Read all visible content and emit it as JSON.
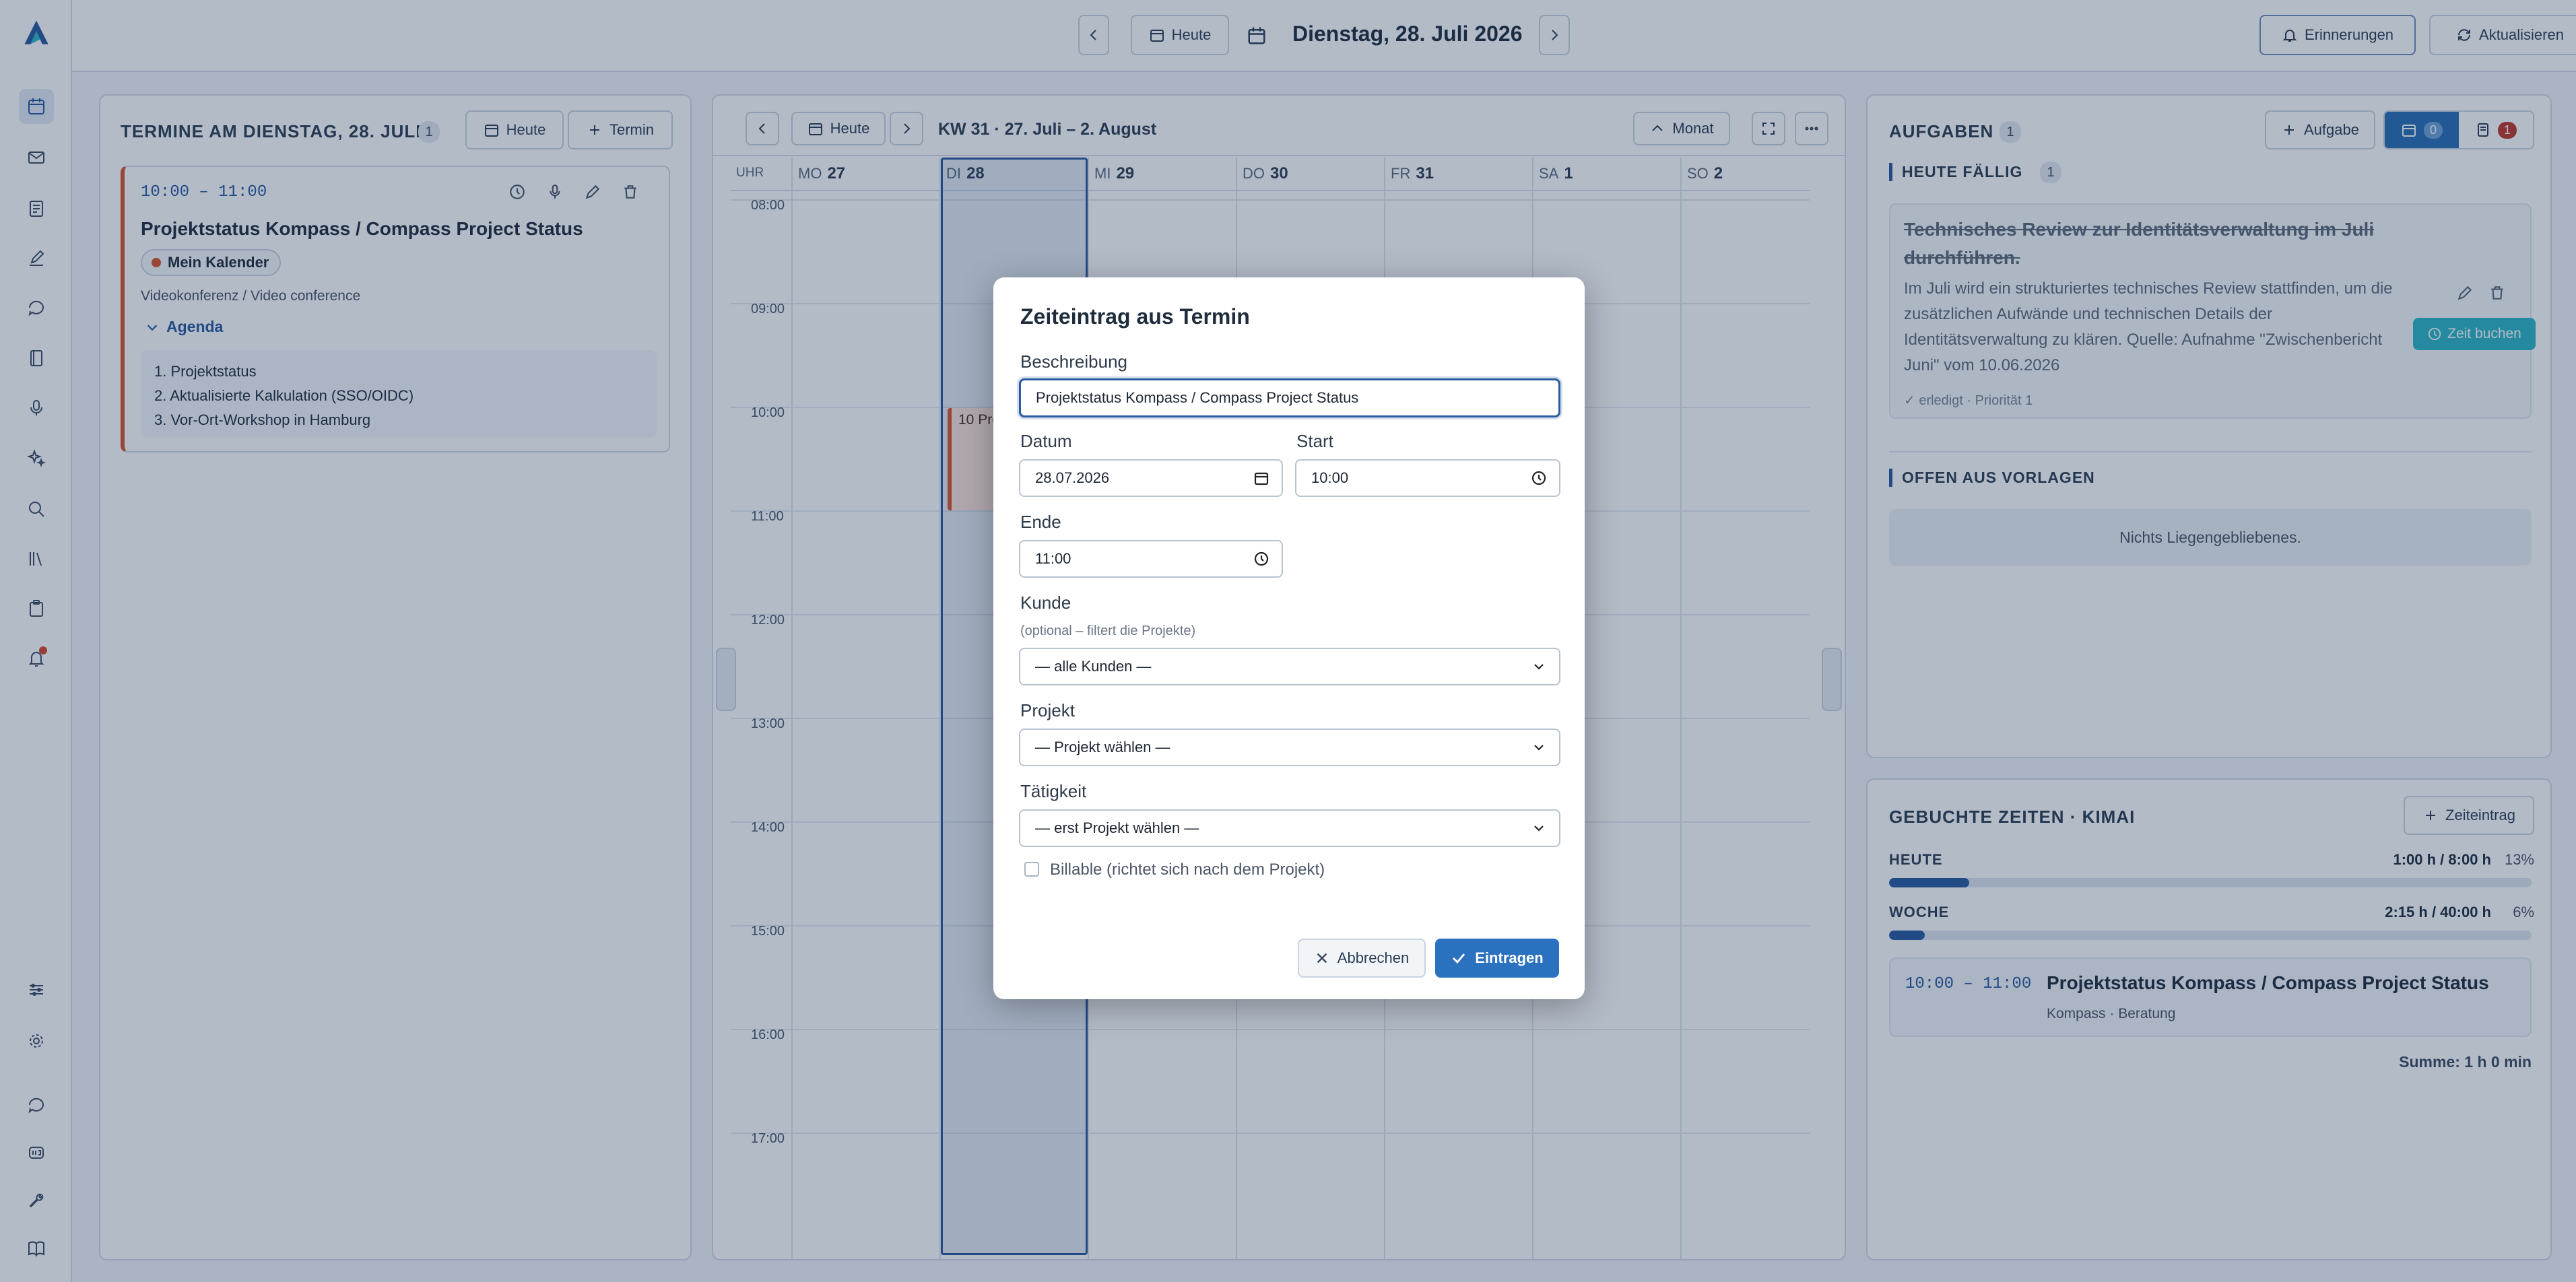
{
  "topbar": {
    "today": "Heute",
    "date": "Dienstag, 28. Juli 2026",
    "reminders": "Erinnerungen",
    "refresh": "Aktualisieren"
  },
  "left": {
    "title": "TERMINE AM DIENSTAG, 28. JULI",
    "count": "1",
    "today": "Heute",
    "add": "Termin",
    "event": {
      "time": "10:00 – 11:00",
      "title": "Projektstatus Kompass / Compass Project Status",
      "calendar": "Mein Kalender",
      "location": "Videokonferenz / Video conference",
      "agenda_label": "Agenda",
      "agenda": [
        "1. Projektstatus",
        "2. Aktualisierte Kalkulation (SSO/OIDC)",
        "3. Vor-Ort-Workshop in Hamburg"
      ]
    }
  },
  "calendar": {
    "today": "Heute",
    "range": "KW 31 · 27. Juli – 2. August",
    "view": "Monat",
    "time_header": "UHR",
    "days": [
      {
        "d": "MO",
        "n": "27"
      },
      {
        "d": "DI",
        "n": "28"
      },
      {
        "d": "MI",
        "n": "29"
      },
      {
        "d": "DO",
        "n": "30"
      },
      {
        "d": "FR",
        "n": "31"
      },
      {
        "d": "SA",
        "n": "1"
      },
      {
        "d": "SO",
        "n": "2"
      }
    ],
    "hours": [
      "08:00",
      "09:00",
      "10:00",
      "11:00",
      "12:00",
      "13:00",
      "14:00",
      "15:00",
      "16:00",
      "17:00"
    ],
    "event_time": "10",
    "event_text": "Pro"
  },
  "tasks": {
    "title": "AUFGABEN",
    "count": "1",
    "add": "Aufgabe",
    "cal_count": "0",
    "doc_count": "1",
    "due_label": "HEUTE FÄLLIG",
    "due_count": "1",
    "item": {
      "title": "Technisches Review zur Identitätsverwaltung im Juli durchführen.",
      "desc": "Im Juli wird ein strukturiertes technisches Review stattfinden, um die zusätzlichen Aufwände und technischen Details der Identitätsverwaltung zu klären. Quelle: Aufnahme \"Zwischenbericht Juni\" vom 10.06.2026",
      "meta": "✓ erledigt · Priorität 1",
      "book": "Zeit buchen"
    },
    "open_label": "OFFEN AUS VORLAGEN",
    "open_empty": "Nichts Liegengebliebenes."
  },
  "times": {
    "title": "GEBUCHTE ZEITEN · KIMAI",
    "add": "Zeiteintrag",
    "today_label": "HEUTE",
    "today_value": "1:00 h / 8:00 h",
    "today_pct": "13%",
    "today_frac": 0.125,
    "week_label": "WOCHE",
    "week_value": "2:15 h / 40:00 h",
    "week_pct": "6%",
    "week_frac": 0.056,
    "entry_time": "10:00 – 11:00",
    "entry_title": "Projektstatus Kompass / Compass Project Status",
    "entry_sub": "Kompass · Beratung",
    "sum": "Summe: 1 h 0 min"
  },
  "modal": {
    "title": "Zeiteintrag aus Termin",
    "desc_label": "Beschreibung",
    "desc_value": "Projektstatus Kompass / Compass Project Status",
    "date_label": "Datum",
    "date_value": "28.07.2026",
    "start_label": "Start",
    "start_value": "10:00",
    "end_label": "Ende",
    "end_value": "11:00",
    "customer_label": "Kunde",
    "customer_hint": "(optional – filtert die Projekte)",
    "customer_value": "— alle Kunden —",
    "project_label": "Projekt",
    "project_value": "— Projekt wählen —",
    "activity_label": "Tätigkeit",
    "activity_value": "— erst Projekt wählen —",
    "billable": "Billable (richtet sich nach dem Projekt)",
    "cancel": "Abbrechen",
    "submit": "Eintragen"
  }
}
